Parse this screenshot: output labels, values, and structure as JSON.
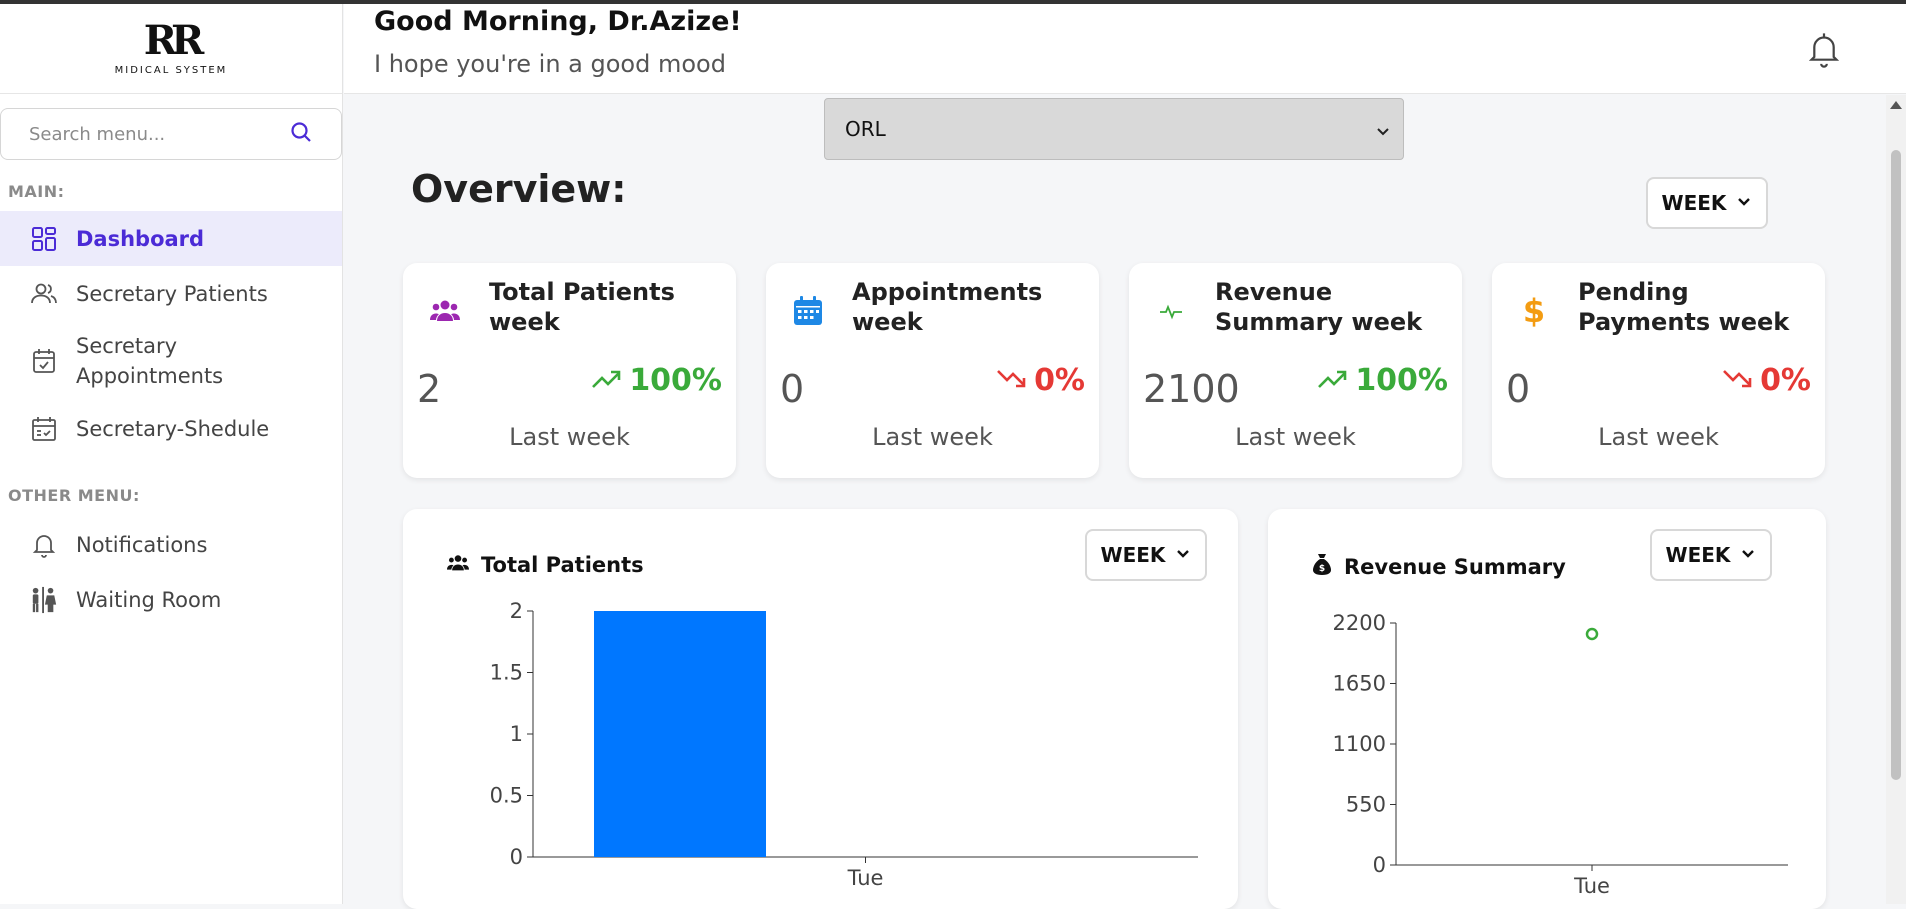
{
  "app": {
    "logo_top": "RR",
    "logo_text": "MIDICAL SYSTEM"
  },
  "search": {
    "placeholder": "Search menu..."
  },
  "sidebar": {
    "main_label": "MAIN:",
    "other_label": "OTHER MENU:",
    "main_items": [
      {
        "label": "Dashboard",
        "icon": "dashboard-icon",
        "active": true
      },
      {
        "label": "Secretary Patients",
        "icon": "users-icon"
      },
      {
        "label": "Secretary\nAppointments",
        "icon": "calendar-check-icon"
      },
      {
        "label": "Secretary-Shedule",
        "icon": "schedule-icon"
      }
    ],
    "other_items": [
      {
        "label": "Notifications",
        "icon": "bell-icon"
      },
      {
        "label": "Waiting Room",
        "icon": "waiting-room-icon"
      }
    ]
  },
  "header": {
    "greeting": "Good Morning, Dr.Azize!",
    "subtitle": "I hope you're in a good mood"
  },
  "main": {
    "specialty_select": "ORL",
    "overview_title": "Overview:",
    "period": "WEEK"
  },
  "cards": [
    {
      "title": "Total Patients week",
      "value": "2",
      "change": "100%",
      "trend": "up",
      "compare": "Last week",
      "icon": "users-icon",
      "icon_color": "#9c27b0"
    },
    {
      "title": "Appointments week",
      "value": "0",
      "change": "0%",
      "trend": "down",
      "compare": "Last week",
      "icon": "calendar-icon",
      "icon_color": "#1e88e5"
    },
    {
      "title": "Revenue Summary week",
      "value": "2100",
      "change": "100%",
      "trend": "up",
      "compare": "Last week",
      "icon": "pulse-icon",
      "icon_color": "#3aaa3a"
    },
    {
      "title": "Pending Payments week",
      "value": "0",
      "change": "0%",
      "trend": "down",
      "compare": "Last week",
      "icon": "dollar-icon",
      "icon_color": "#f39c12"
    }
  ],
  "panels": {
    "patients": {
      "title": "Total Patients",
      "period": "WEEK"
    },
    "revenue": {
      "title": "Revenue Summary",
      "period": "WEEK"
    }
  },
  "colors": {
    "accent": "#4b2bd6",
    "bar": "#0077ff",
    "up": "#3aaa3a",
    "down": "#e53935"
  },
  "chart_data": [
    {
      "type": "bar",
      "title": "Total Patients",
      "categories": [
        "Tue"
      ],
      "values": [
        2
      ],
      "ylim": [
        0,
        2
      ],
      "yticks": [
        0,
        0.5,
        1,
        1.5,
        2
      ],
      "xlabel": "",
      "ylabel": "",
      "grid": false
    },
    {
      "type": "scatter",
      "title": "Revenue Summary",
      "categories": [
        "Tue"
      ],
      "values": [
        2100
      ],
      "ylim": [
        0,
        2200
      ],
      "yticks": [
        0,
        550,
        1100,
        1650,
        2200
      ],
      "xlabel": "",
      "ylabel": "",
      "grid": false
    }
  ]
}
